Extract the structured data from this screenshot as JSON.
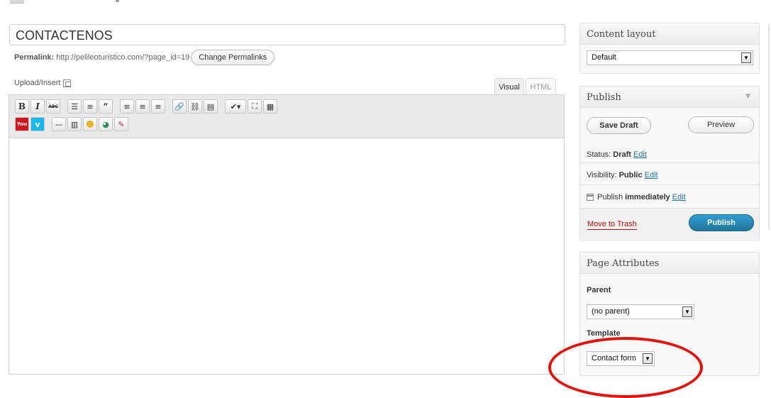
{
  "post": {
    "title": "CONTACTENOS",
    "permalink_label": "Permalink:",
    "permalink_url": "http://pelileoturistico.com/?page_id=19",
    "change_permalinks_label": "Change Permalinks"
  },
  "editor": {
    "upload_insert_label": "Upload/Insert",
    "tabs": [
      {
        "label": "Visual",
        "active": true
      },
      {
        "label": "HTML",
        "active": false
      }
    ],
    "toolbar_row1": [
      "bold-icon",
      "italic-icon",
      "strikethrough-icon",
      "bullet-list-icon",
      "numbered-list-icon",
      "blockquote-icon",
      "align-left-icon",
      "align-center-icon",
      "align-right-icon",
      "link-icon",
      "unlink-icon",
      "more-tag-icon",
      "spellcheck-icon",
      "fullscreen-icon",
      "kitchen-sink-icon"
    ],
    "toolbar_row2": [
      "youtube-icon",
      "vimeo-icon",
      "horizontal-rule-icon",
      "columns-icon",
      "emoticon-icon",
      "gallery-icon",
      "shortcode-icon"
    ],
    "content": ""
  },
  "content_layout": {
    "heading": "Content layout",
    "selected": "Default"
  },
  "publish": {
    "heading": "Publish",
    "save_draft_label": "Save Draft",
    "preview_label": "Preview",
    "status_label": "Status:",
    "status_value": "Draft",
    "visibility_label": "Visibility:",
    "visibility_value": "Public",
    "schedule_label": "Publish",
    "schedule_value": "immediately",
    "edit_label": "Edit",
    "move_to_trash_label": "Move to Trash",
    "publish_label": "Publish"
  },
  "page_attributes": {
    "heading": "Page Attributes",
    "parent_label": "Parent",
    "parent_selected": "(no parent)",
    "template_label": "Template",
    "template_selected": "Contact form"
  },
  "colors": {
    "link": "#21759b",
    "trash": "#bc0b0b",
    "publish_button": "#21759b",
    "annotation": "#e3120b"
  }
}
